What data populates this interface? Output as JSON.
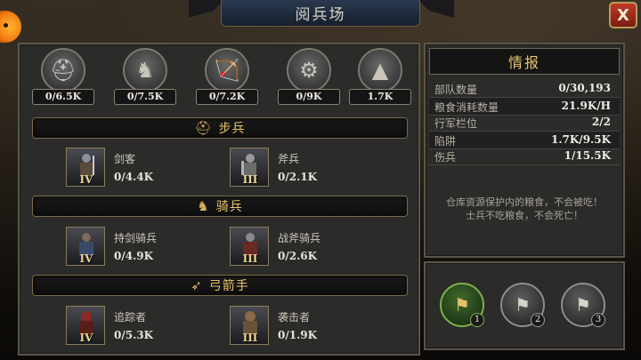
{
  "header": {
    "title": "阅兵场",
    "close_label": "X"
  },
  "totals": [
    {
      "icon": "infantry-helmet-icon",
      "glyph": "⛑",
      "value": "0/6.5K"
    },
    {
      "icon": "cavalry-horse-icon",
      "glyph": "♞",
      "value": "0/7.5K"
    },
    {
      "icon": "archer-bow-icon",
      "glyph": "🏹",
      "value": "0/7.2K"
    },
    {
      "icon": "siege-catapult-icon",
      "glyph": "⚙",
      "value": "0/9K"
    },
    {
      "icon": "trap-spikes-icon",
      "glyph": "▲",
      "value": "1.7K"
    }
  ],
  "categories": {
    "infantry": {
      "label": "步兵",
      "icon": "helmet-icon",
      "glyph": "⛑"
    },
    "cavalry": {
      "label": "骑兵",
      "icon": "horse-head-icon",
      "glyph": "♞"
    },
    "archer": {
      "label": "弓箭手",
      "icon": "bow-icon",
      "glyph": "➶"
    }
  },
  "units": {
    "swordsman": {
      "name": "剑客",
      "count": "0/4.4K",
      "tier": "IV"
    },
    "axeman": {
      "name": "斧兵",
      "count": "0/2.1K",
      "tier": "III"
    },
    "sword_cavalry": {
      "name": "持剑骑兵",
      "count": "0/4.9K",
      "tier": "IV"
    },
    "axe_cavalry": {
      "name": "战斧骑兵",
      "count": "0/2.6K",
      "tier": "III"
    },
    "tracker": {
      "name": "追踪者",
      "count": "0/5.3K",
      "tier": "IV"
    },
    "raider": {
      "name": "袭击者",
      "count": "0/1.9K",
      "tier": "III"
    }
  },
  "info": {
    "title": "情报",
    "stats": [
      {
        "label": "部队数量",
        "value": "0/30,193"
      },
      {
        "label": "粮食消耗数量",
        "value": "21.9K/H"
      },
      {
        "label": "行军栏位",
        "value": "2/2"
      },
      {
        "label": "陷阱",
        "value": "1.7K/9.5K"
      },
      {
        "label": "伤兵",
        "value": "1/15.5K"
      }
    ],
    "note_line1": "仓库资源保护内的粮食，不会被吃！",
    "note_line2": "士兵不吃粮食，不会死亡！"
  },
  "flags": [
    {
      "num": "1",
      "active": true
    },
    {
      "num": "2",
      "active": false
    },
    {
      "num": "3",
      "active": false
    }
  ],
  "colors": {
    "accent_gold": "#e8c46c",
    "panel": "#2b2b29",
    "close_red": "#c23a26",
    "flag_active": "#7eb04a"
  }
}
